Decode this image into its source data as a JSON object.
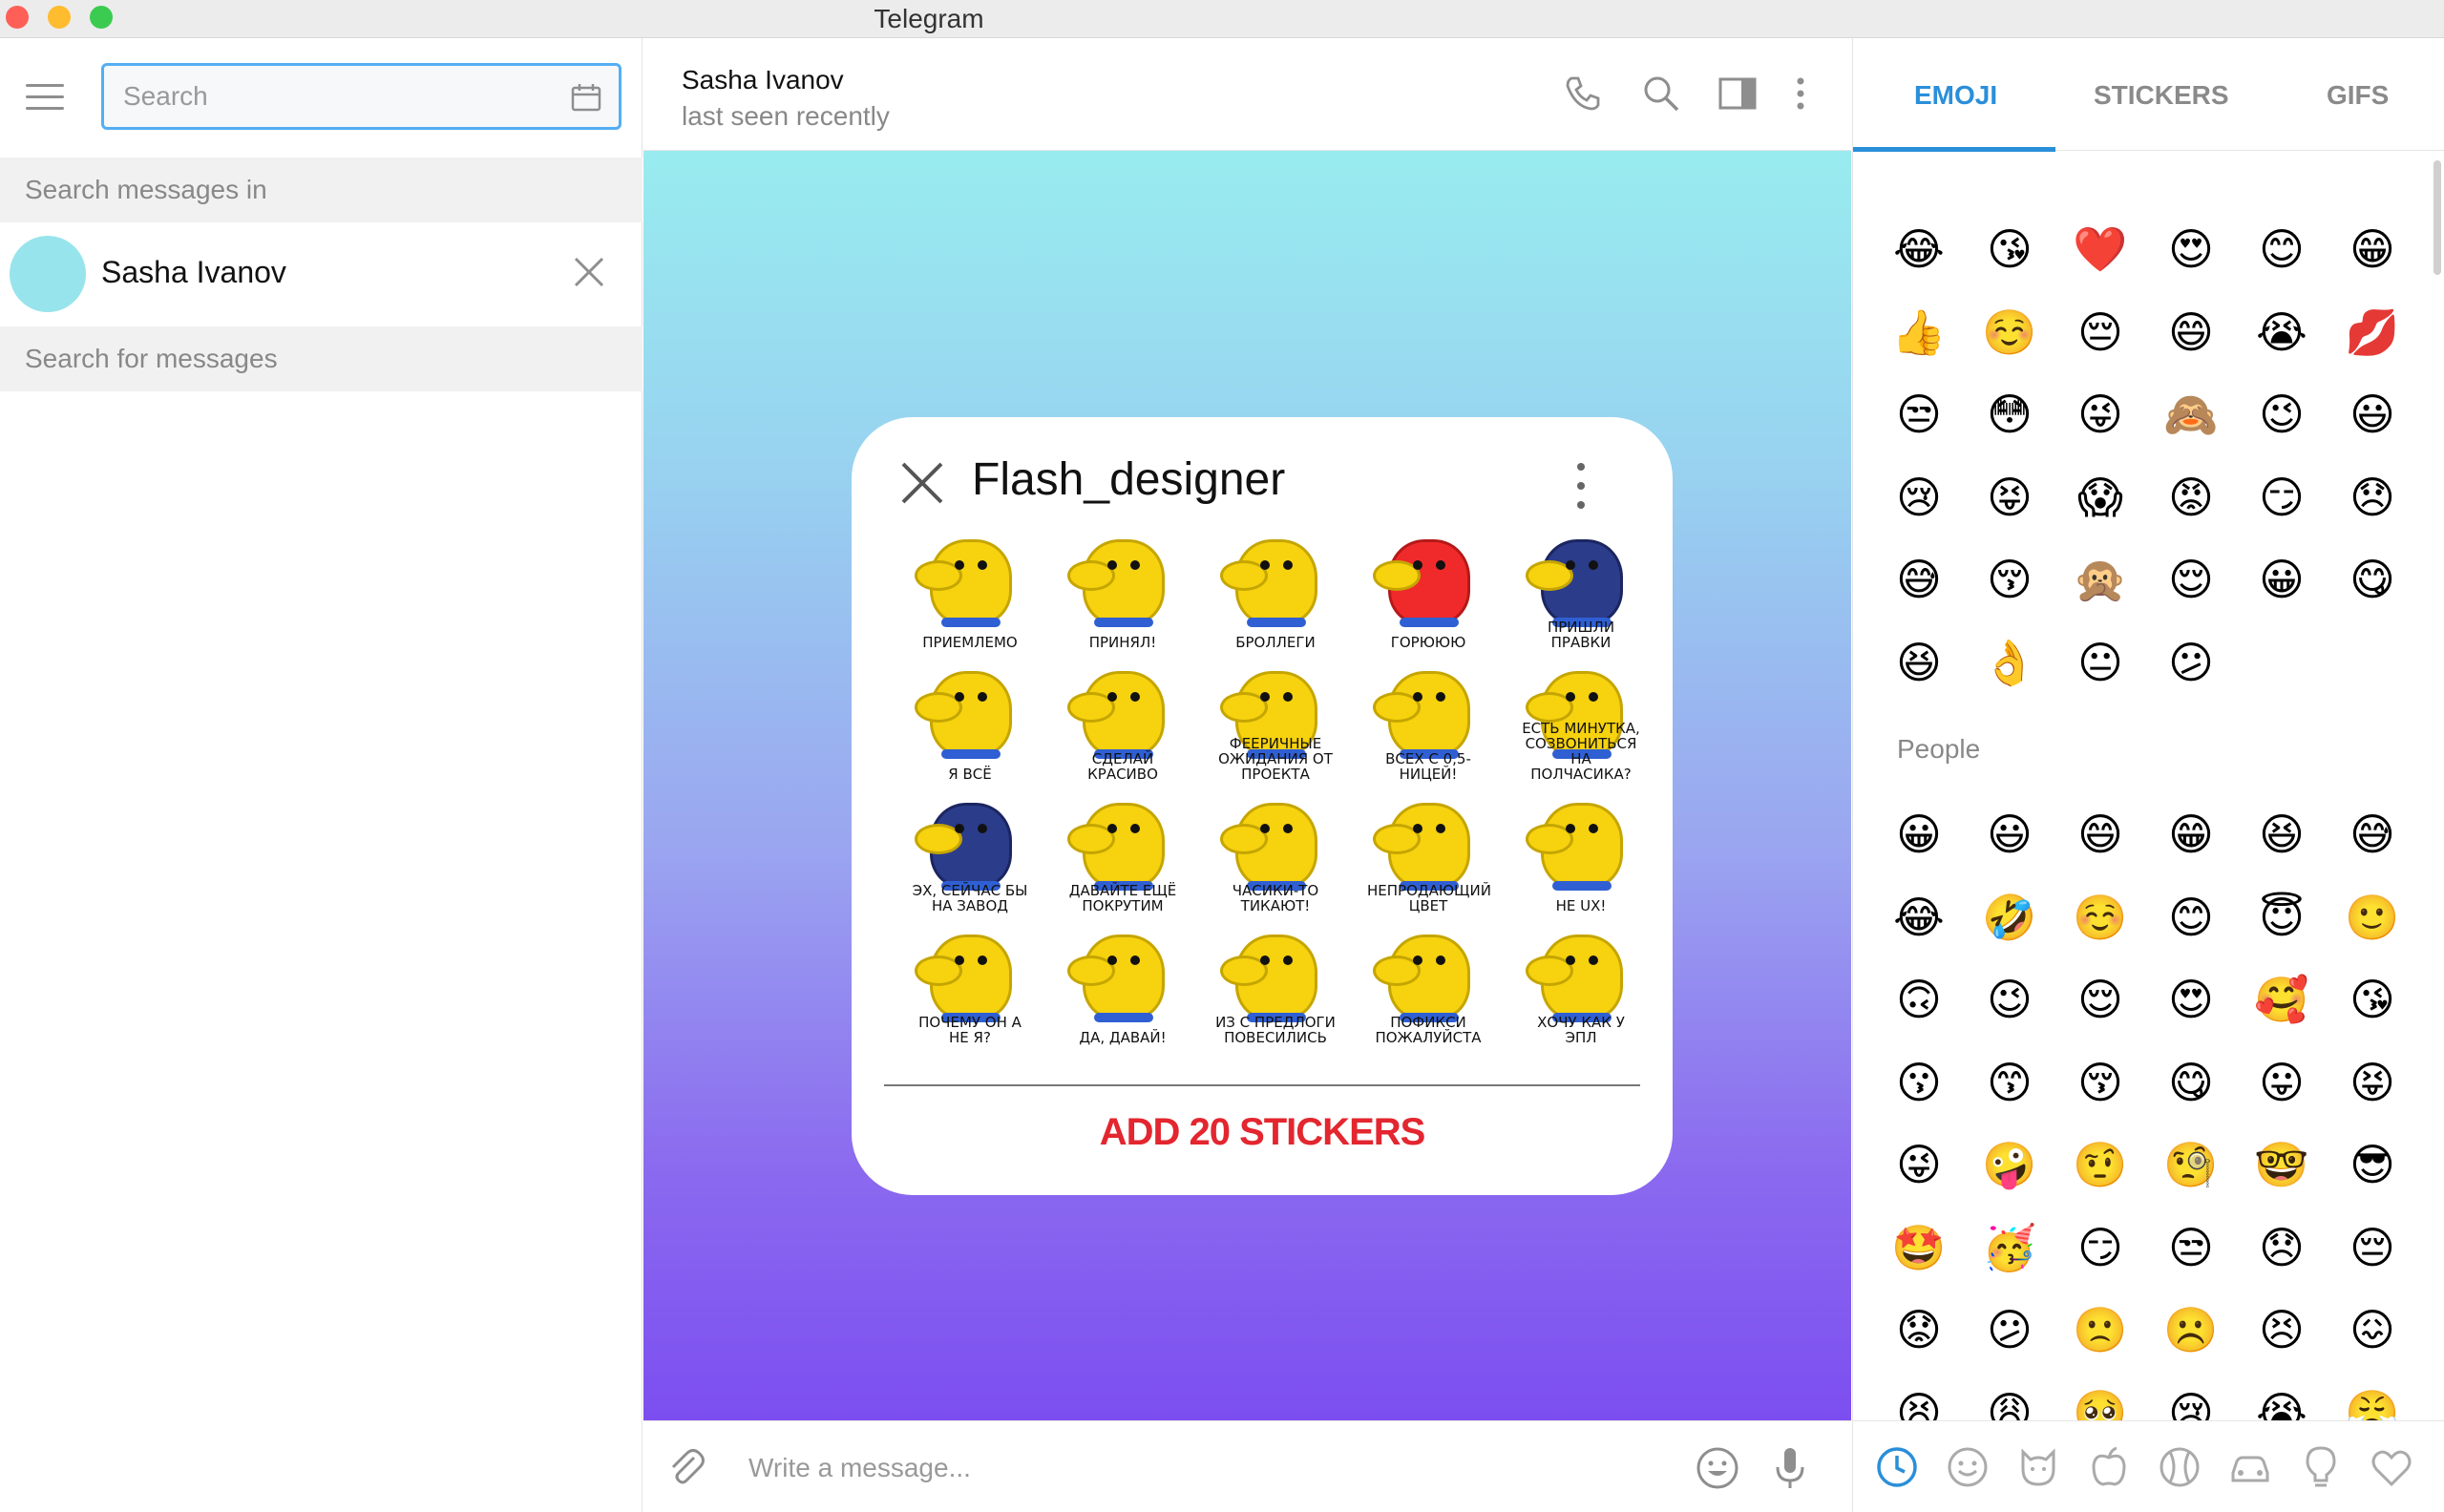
{
  "window": {
    "title": "Telegram"
  },
  "left": {
    "search_placeholder": "Search",
    "search_in_label": "Search messages in",
    "chip_name": "Sasha Ivanov",
    "search_for_label": "Search for messages"
  },
  "chat": {
    "peer_name": "Sasha Ivanov",
    "peer_status": "last seen recently",
    "compose_placeholder": "Write a message..."
  },
  "sticker_set": {
    "title": "Flash_designer",
    "add_label": "ADD 20 STICKERS",
    "stickers": [
      {
        "caption": "ПРИЕМЛЕМО"
      },
      {
        "caption": "ПРИНЯЛ!"
      },
      {
        "caption": "БРОЛЛЕГИ"
      },
      {
        "caption": "ГОРЮЮЮ"
      },
      {
        "caption": "ПРИШЛИ ПРАВКИ"
      },
      {
        "caption": "Я ВСЁ"
      },
      {
        "caption": "СДЕЛАЙ КРАСИВО"
      },
      {
        "caption": "ФЕЕРИЧНЫЕ ОЖИДАНИЯ ОТ ПРОЕКТА"
      },
      {
        "caption": "ВСЕХ С 0,5-НИЦЕЙ!"
      },
      {
        "caption": "ЕСТЬ МИНУТКА, СОЗВОНИТЬСЯ НА ПОЛЧАСИКА?"
      },
      {
        "caption": "ЭХ, СЕЙЧАС БЫ НА ЗАВОД"
      },
      {
        "caption": "ДАВАЙТЕ ЕЩЁ ПОКРУТИМ"
      },
      {
        "caption": "ЧАСИКИ-ТО ТИКАЮТ!"
      },
      {
        "caption": "НЕПРОДАЮЩИЙ ЦВЕТ"
      },
      {
        "caption": "НЕ UX!"
      },
      {
        "caption": "ПОЧЕМУ ОН А НЕ Я?"
      },
      {
        "caption": "ДА, ДАВАЙ!"
      },
      {
        "caption": "ИЗ С ПРЕДЛОГИ ПОВЕСИЛИСЬ"
      },
      {
        "caption": "ПОФИКСИ ПОЖАЛУЙСТА"
      },
      {
        "caption": "ХОЧУ КАК У ЭПЛ"
      }
    ]
  },
  "emoji_panel": {
    "tabs": [
      "EMOJI",
      "STICKERS",
      "GIFS"
    ],
    "active_tab": "EMOJI",
    "accent_color": "#2a8fd9",
    "recent": [
      [
        "😂",
        "😘",
        "❤️",
        "😍",
        "😊",
        "😁"
      ],
      [
        "👍",
        "☺️",
        "😔",
        "😄",
        "😭",
        "💋"
      ],
      [
        "😒",
        "😳",
        "😜",
        "🙈",
        "😉",
        "😃"
      ],
      [
        "😢",
        "😝",
        "😱",
        "😡",
        "😏",
        "😞"
      ],
      [
        "😅",
        "😚",
        "🙊",
        "😌",
        "😀",
        "😋"
      ],
      [
        "😆",
        "👌",
        "😐",
        "😕"
      ]
    ],
    "people_label": "People",
    "people": [
      [
        "😀",
        "😃",
        "😄",
        "😁",
        "😆",
        "😅"
      ],
      [
        "😂",
        "🤣",
        "☺️",
        "😊",
        "😇",
        "🙂"
      ],
      [
        "🙃",
        "😉",
        "😌",
        "😍",
        "🥰",
        "😘"
      ],
      [
        "😗",
        "😙",
        "😚",
        "😋",
        "😛",
        "😝"
      ],
      [
        "😜",
        "🤪",
        "🤨",
        "🧐",
        "🤓",
        "😎"
      ],
      [
        "🤩",
        "🥳",
        "😏",
        "😒",
        "😞",
        "😔"
      ],
      [
        "😟",
        "😕",
        "🙁",
        "☹️",
        "😣",
        "😖"
      ],
      [
        "😫",
        "😩",
        "🥺",
        "😢",
        "😭",
        "😤"
      ]
    ],
    "categories": [
      "recent-icon",
      "smileys-icon",
      "animals-icon",
      "food-icon",
      "activity-icon",
      "travel-icon",
      "objects-icon",
      "symbols-icon"
    ]
  }
}
